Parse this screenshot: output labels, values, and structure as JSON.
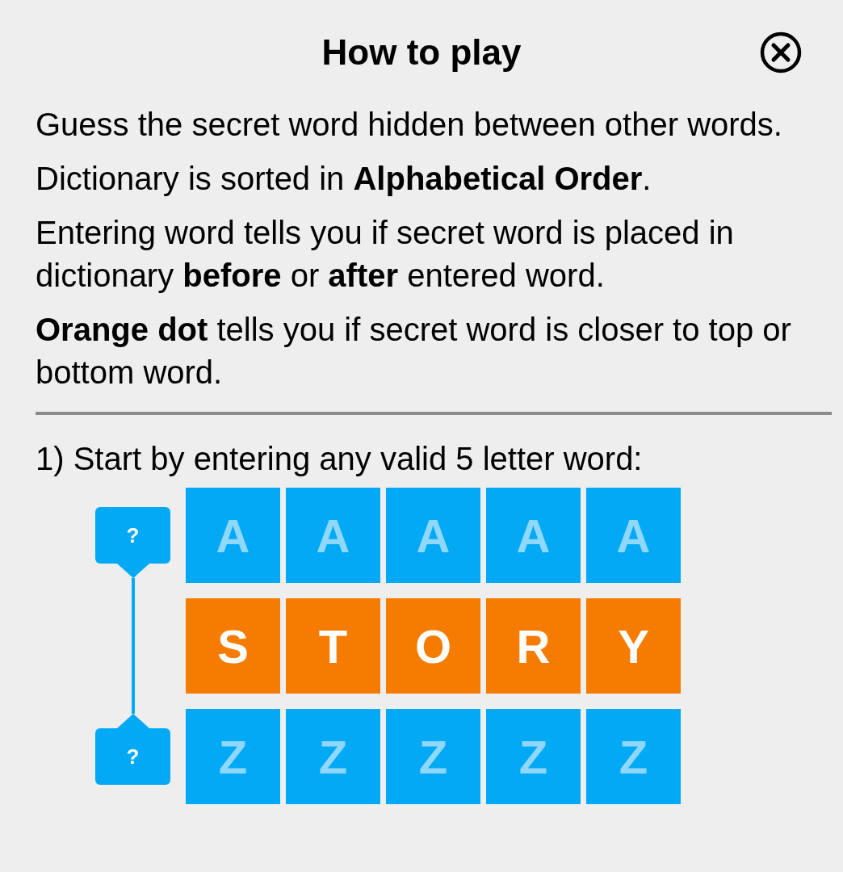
{
  "dialog": {
    "title": "How to play"
  },
  "paragraphs": [
    "Guess the secret word hidden between other words.",
    "Dictionary is sorted in **Alphabetical Order**.",
    "Entering word tells you if secret word is placed in dictionary **before** or **after** entered word.",
    "**Orange dot** tells you if secret word is closer to top or bottom word."
  ],
  "step": {
    "label": "1) Start by entering any valid 5 letter word:",
    "markers": [
      {
        "label": "?"
      },
      {
        "label": "?"
      }
    ],
    "rows": [
      {
        "kind": "bound",
        "letters": [
          "A",
          "A",
          "A",
          "A",
          "A"
        ]
      },
      {
        "kind": "guess",
        "letters": [
          "S",
          "T",
          "O",
          "R",
          "Y"
        ]
      },
      {
        "kind": "bound",
        "letters": [
          "Z",
          "Z",
          "Z",
          "Z",
          "Z"
        ]
      }
    ]
  }
}
